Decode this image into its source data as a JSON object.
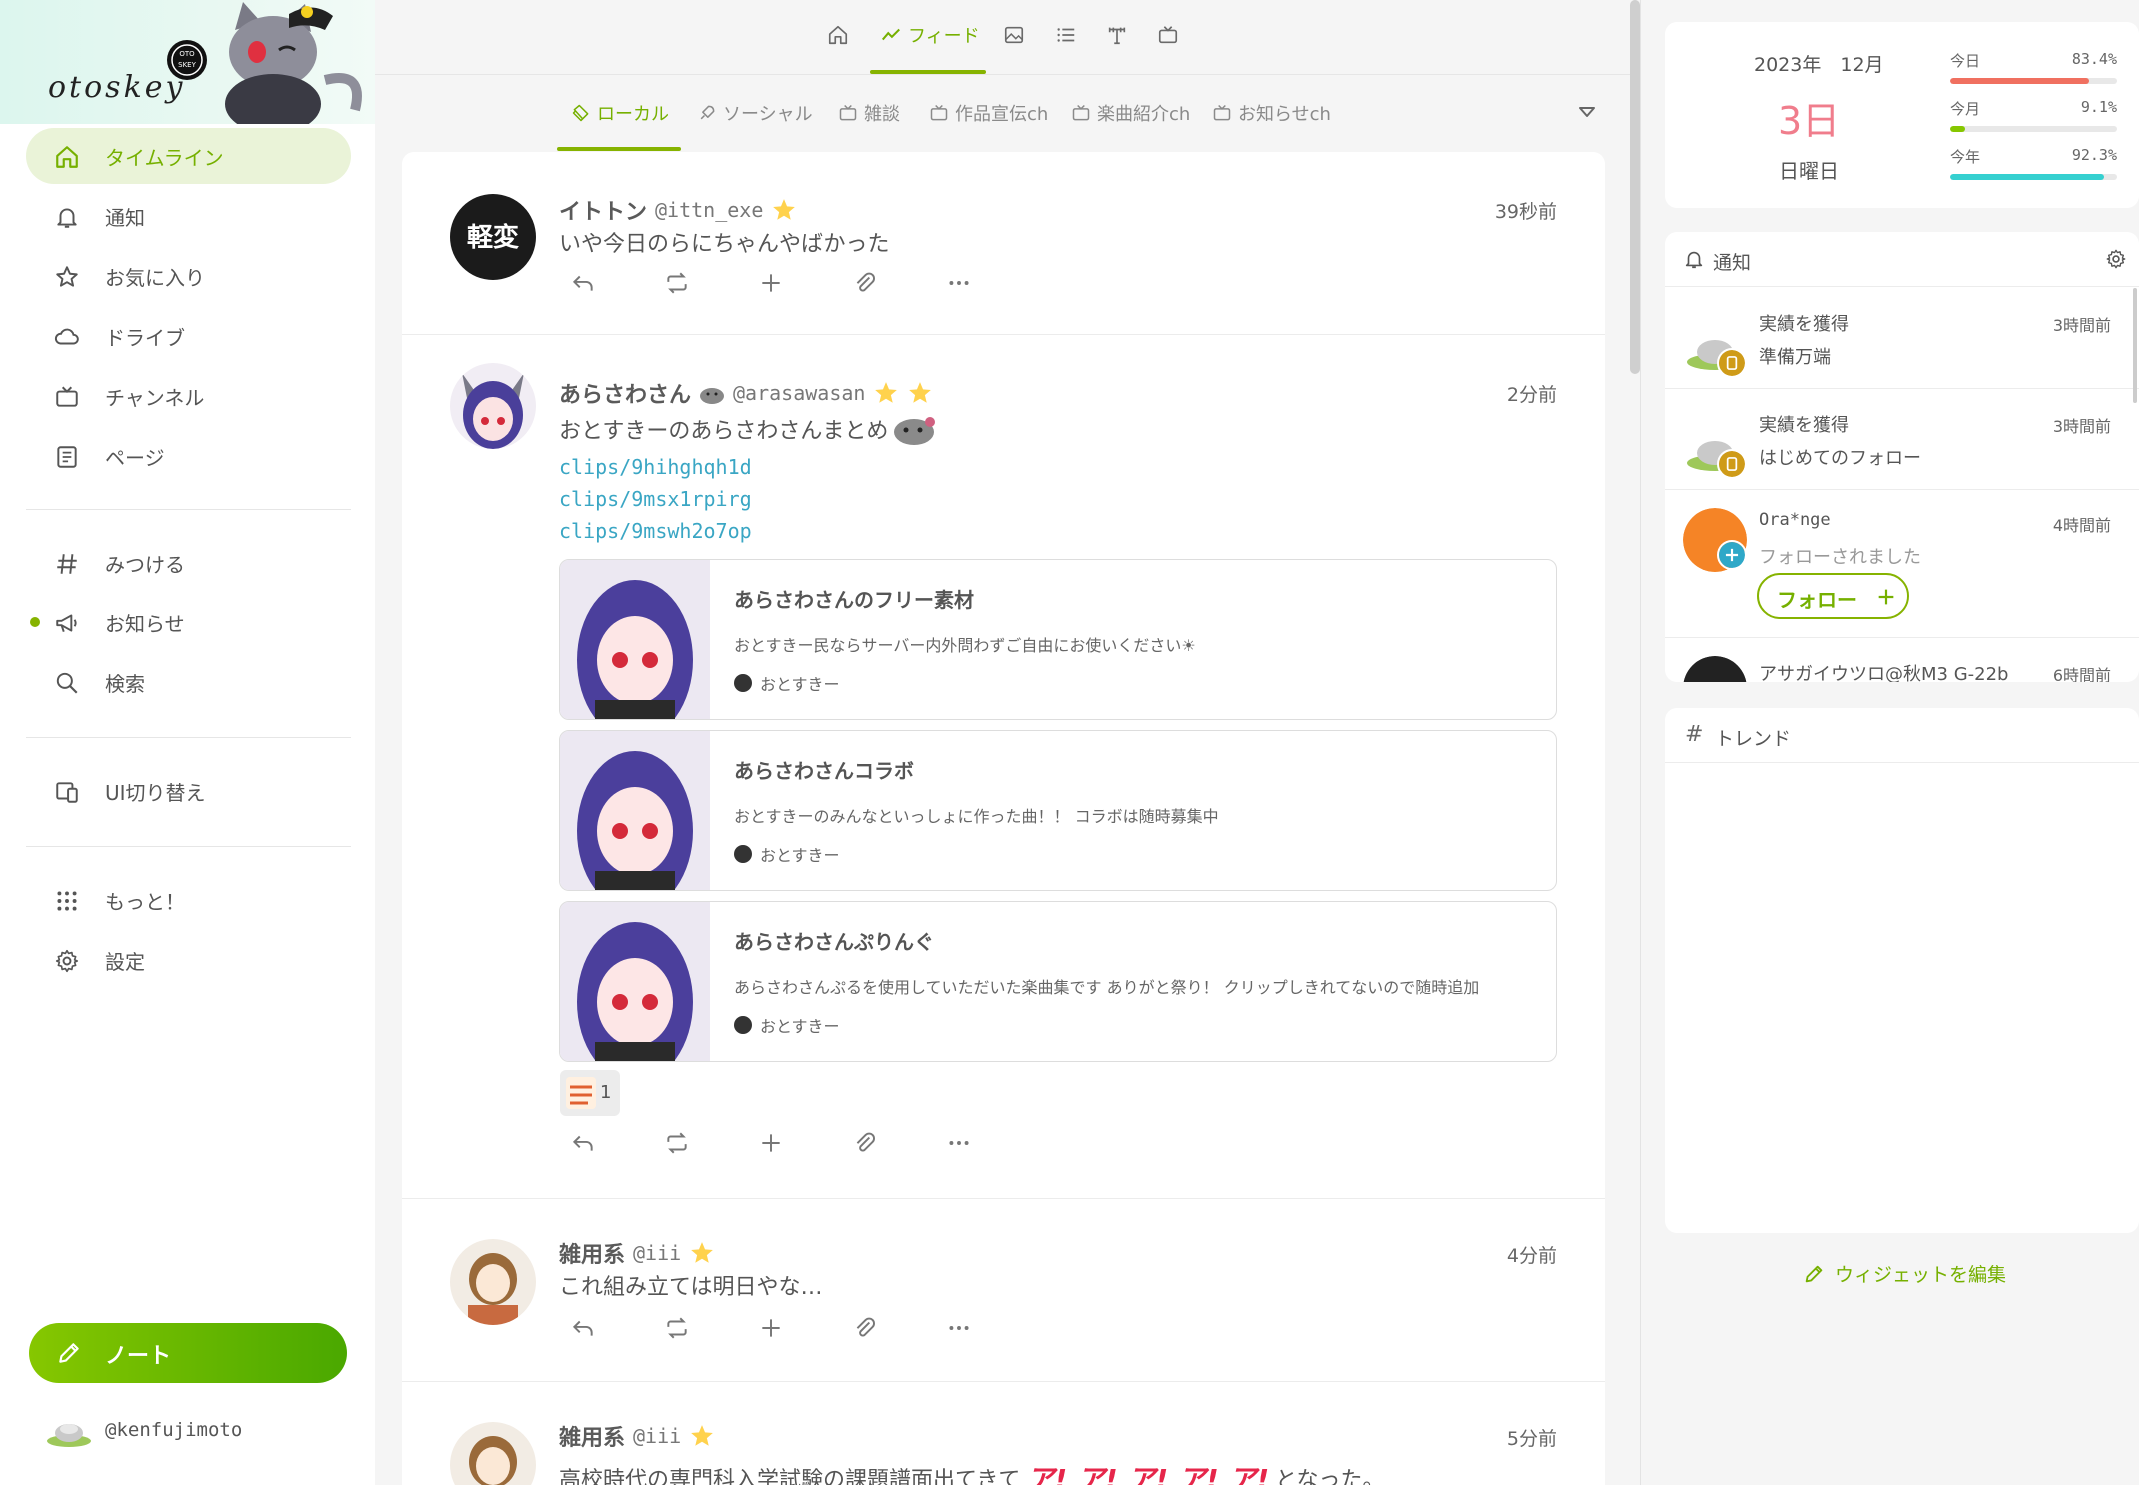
{
  "sidebar": {
    "logo": "otoskey",
    "nav": [
      {
        "label": "タイムライン"
      },
      {
        "label": "通知"
      },
      {
        "label": "お気に入り"
      },
      {
        "label": "ドライブ"
      },
      {
        "label": "チャンネル"
      },
      {
        "label": "ページ"
      },
      {
        "label": "みつける"
      },
      {
        "label": "お知らせ"
      },
      {
        "label": "検索"
      },
      {
        "label": "UI切り替え"
      },
      {
        "label": "もっと！"
      },
      {
        "label": "設定"
      }
    ],
    "note_button": "ノート",
    "account": "@kenfujimoto"
  },
  "top_tabs": [
    {
      "label": "",
      "icon": "home-icon"
    },
    {
      "label": "フィード",
      "icon": "feed-icon"
    },
    {
      "label": "",
      "icon": "image-icon"
    },
    {
      "label": "",
      "icon": "list-icon"
    },
    {
      "label": "",
      "icon": "antenna-icon"
    },
    {
      "label": "",
      "icon": "channel-icon"
    }
  ],
  "sub_tabs": [
    {
      "label": "ローカル"
    },
    {
      "label": "ソーシャル"
    },
    {
      "label": "雑談"
    },
    {
      "label": "作品宣伝ch"
    },
    {
      "label": "楽曲紹介ch"
    },
    {
      "label": "お知らせch"
    }
  ],
  "notes": [
    {
      "name": "イトトン",
      "handle": "@ittn_exe",
      "time": "39秒前",
      "text": "いや今日のらにちゃんやばかった",
      "avatar_text": "軽変"
    },
    {
      "name": "あらさわさん",
      "handle": "@arasawasan",
      "time": "2分前",
      "text": "おとすきーのあらさわさんまとめ",
      "links": [
        "clips/9hihghqh1d",
        "clips/9msx1rpirg",
        "clips/9mswh2o7op"
      ],
      "clips": [
        {
          "title": "あらさわさんのフリー素材",
          "desc": "おとすきー民ならサーバー内外問わずご自由にお使いください☀",
          "site": "おとすきー"
        },
        {
          "title": "あらさわさんコラボ",
          "desc": "おとすきーのみんなといっしょに作った曲！！ コラボは随時募集中",
          "site": "おとすきー"
        },
        {
          "title": "あらさわさんぷりんぐ",
          "desc": "あらさわさんぷるを使用していただいた楽曲集です ありがと祭り！ クリップしきれてないので随時追加",
          "site": "おとすきー"
        }
      ],
      "reaction_count": "1"
    },
    {
      "name": "雑用系",
      "handle": "@iii",
      "time": "4分前",
      "text": "これ組み立ては明日やな…"
    },
    {
      "name": "雑用系",
      "handle": "@iii",
      "time": "5分前",
      "text_before": "高校時代の専門科入学試験の課題譜面出てきて",
      "stamp_text": "ア! ア! ア! ア! ア!",
      "text_after": "となった。"
    }
  ],
  "calendar": {
    "year_month": "2023年　12月",
    "day": "3日",
    "weekday": "日曜日",
    "progress": [
      {
        "label": "今日",
        "value": "83.4%",
        "fraction": 0.834,
        "color": "#f07060"
      },
      {
        "label": "今月",
        "value": "9.1%",
        "fraction": 0.091,
        "color": "#86c700"
      },
      {
        "label": "今年",
        "value": "92.3%",
        "fraction": 0.923,
        "color": "#35d0d0"
      }
    ]
  },
  "notifications": {
    "title": "通知",
    "items": [
      {
        "line1": "実績を獲得",
        "line2": "準備万端",
        "time": "3時間前"
      },
      {
        "line1": "実績を獲得",
        "line2": "はじめてのフォロー",
        "time": "3時間前"
      },
      {
        "line1": "Ora*nge",
        "line2": "フォローされました",
        "time": "4時間前",
        "follow_label": "フォロー"
      },
      {
        "line1": "アサガイウツロ@秋M3 G-22b",
        "time": "6時間前"
      }
    ]
  },
  "trend": {
    "title": "トレンド"
  },
  "edit_widgets": "ウィジェットを編集"
}
